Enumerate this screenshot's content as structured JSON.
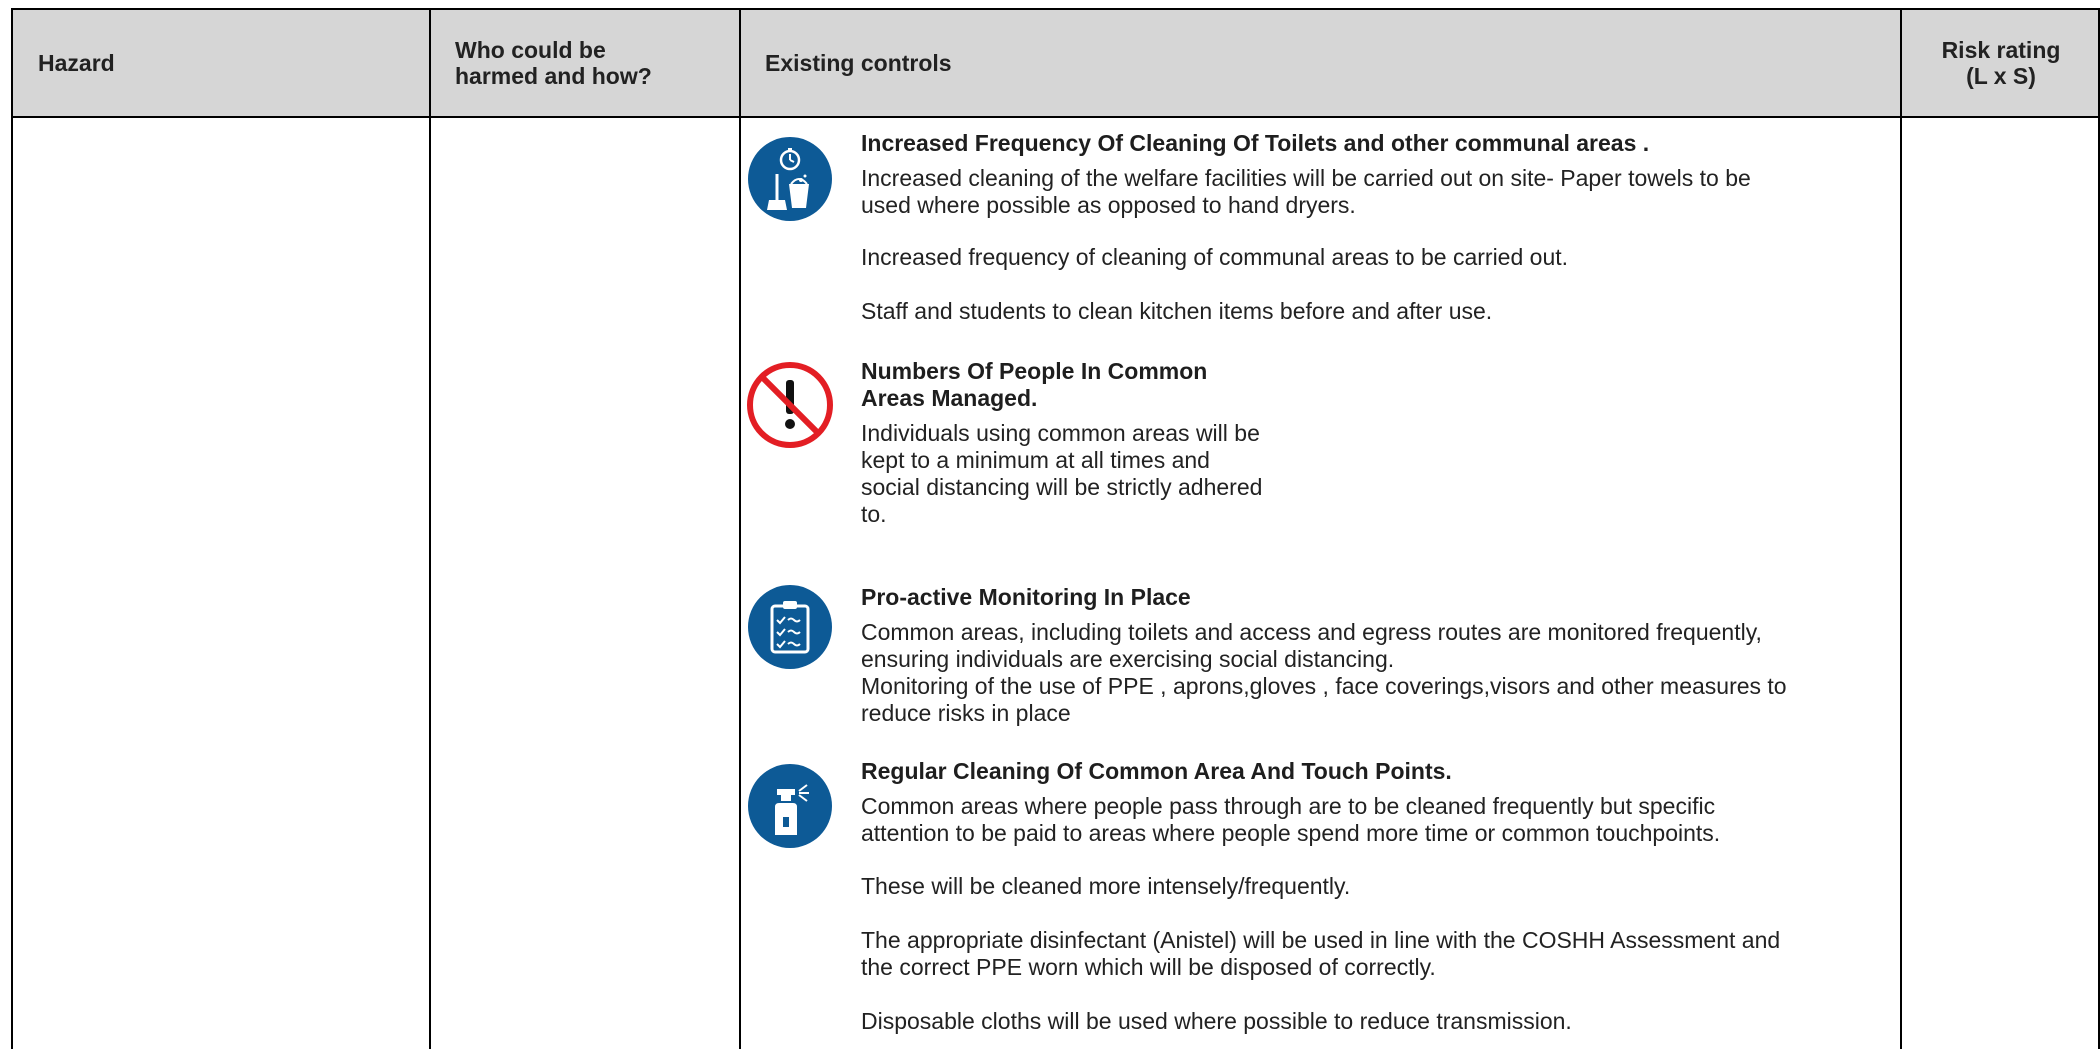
{
  "table": {
    "headers": {
      "hazard": "Hazard",
      "who_line1": "Who could be",
      "who_line2": "harmed and how?",
      "controls": "Existing controls",
      "risk_line1": "Risk rating",
      "risk_line2": "(L x S)"
    },
    "controls": [
      {
        "icon": "cleaning-bucket-icon",
        "title": "Increased Frequency Of Cleaning Of Toilets and other communal areas .",
        "p1_line1": "Increased cleaning of the welfare facilities will be carried out on site- Paper towels to be",
        "p1_line2": "used where possible as opposed to hand dryers.",
        "p2": "Increased frequency of cleaning of communal areas to be carried out.",
        "p3": "Staff and students to clean kitchen items before and after use."
      },
      {
        "icon": "prohibition-icon",
        "title_line1": "Numbers Of People In Common",
        "title_line2": "Areas Managed.",
        "p1_line1": "Individuals using common areas will be",
        "p1_line2": "kept to a minimum at all times and",
        "p1_line3": "social distancing will be strictly adhered",
        "p1_line4": "to."
      },
      {
        "icon": "clipboard-checklist-icon",
        "title": "Pro-active Monitoring In Place",
        "p1_line1": "Common areas, including toilets and access and egress routes are monitored frequently,",
        "p1_line2": "ensuring individuals are exercising social distancing.",
        "p1_line3": "Monitoring of the use of PPE , aprons,gloves , face coverings,visors and other measures to",
        "p1_line4": "reduce risks in place"
      },
      {
        "icon": "spray-bottle-icon",
        "title": "Regular Cleaning Of Common Area And Touch Points.",
        "p1_line1": "Common areas where people pass through are to be cleaned frequently but specific",
        "p1_line2": "attention to be paid to areas where people spend more time or common touchpoints.",
        "p2": "These will be cleaned more intensely/frequently.",
        "p3_line1": "The appropriate disinfectant (Anistel) will be used in line with the COSHH Assessment and",
        "p3_line2": "the correct PPE worn which will be disposed of correctly.",
        "p4": "Disposable cloths will be used where possible to reduce transmission."
      }
    ],
    "colors": {
      "header_bg": "#d6d6d6",
      "icon_blue": "#0d5a96",
      "prohibition_red": "#e31e24"
    }
  }
}
